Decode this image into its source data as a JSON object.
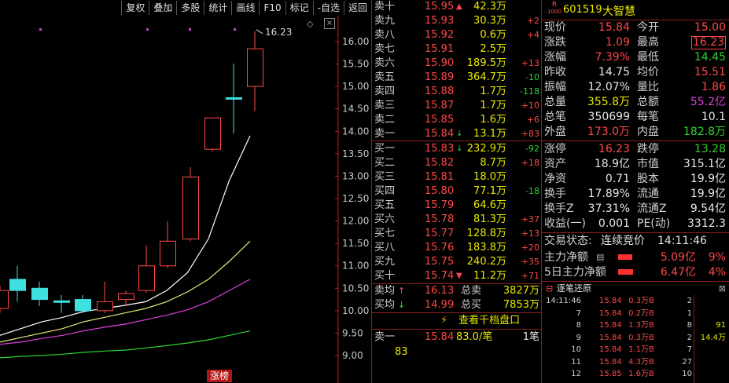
{
  "toolbar": {
    "items": [
      "复权",
      "叠加",
      "多股",
      "统计",
      "画线",
      "F10",
      "标记",
      "-自选",
      "返回"
    ]
  },
  "chart": {
    "y_ticks": [
      "16.00",
      "15.50",
      "15.00",
      "14.50",
      "14.00",
      "13.50",
      "13.00",
      "12.50",
      "12.00",
      "11.50",
      "11.00",
      "10.50",
      "10.00",
      "9.50",
      "9.00"
    ],
    "high_label": "16.23",
    "bottom_tag": "涨榜",
    "diamond": "◇",
    "colors": {
      "up": "#ff4848",
      "down": "#3fe0e0",
      "ma5": "#ffffff",
      "ma10": "#e8e87a",
      "ma20": "#e040e0",
      "ma60": "#2ed32e"
    }
  },
  "chart_data": {
    "type": "candlestick",
    "ylim": [
      8.9,
      16.45
    ],
    "candles": [
      {
        "o": 10.45,
        "h": 10.55,
        "l": 9.95,
        "c": 10.05,
        "dir": "up"
      },
      {
        "o": 10.45,
        "h": 11.0,
        "l": 10.2,
        "c": 10.7,
        "dir": "down"
      },
      {
        "o": 10.5,
        "h": 10.65,
        "l": 10.1,
        "c": 10.25,
        "dir": "down"
      },
      {
        "o": 10.2,
        "h": 10.35,
        "l": 9.95,
        "c": 10.22,
        "dir": "down"
      },
      {
        "o": 10.0,
        "h": 10.35,
        "l": 9.95,
        "c": 10.25,
        "dir": "down"
      },
      {
        "o": 10.0,
        "h": 10.65,
        "l": 9.95,
        "c": 10.2,
        "dir": "up"
      },
      {
        "o": 10.25,
        "h": 10.45,
        "l": 10.1,
        "c": 10.38,
        "dir": "up"
      },
      {
        "o": 10.45,
        "h": 11.45,
        "l": 10.4,
        "c": 11.0,
        "dir": "up"
      },
      {
        "o": 11.0,
        "h": 12.0,
        "l": 10.95,
        "c": 11.55,
        "dir": "up"
      },
      {
        "o": 11.6,
        "h": 13.2,
        "l": 11.55,
        "c": 12.98,
        "dir": "up"
      },
      {
        "o": 13.6,
        "h": 14.3,
        "l": 13.55,
        "c": 14.3,
        "dir": "up"
      },
      {
        "o": 14.75,
        "h": 15.51,
        "l": 13.95,
        "c": 14.75,
        "dir": "down"
      },
      {
        "o": 15.0,
        "h": 16.23,
        "l": 14.45,
        "c": 15.84,
        "dir": "up"
      }
    ],
    "ma": [
      {
        "name": "ma5",
        "values": [
          9.45,
          9.6,
          9.75,
          9.85,
          9.98,
          10.05,
          10.12,
          10.2,
          10.45,
          10.85,
          11.6,
          12.9,
          13.9
        ]
      },
      {
        "name": "ma10",
        "values": [
          9.3,
          9.4,
          9.5,
          9.6,
          9.75,
          9.85,
          9.95,
          10.05,
          10.2,
          10.42,
          10.7,
          11.1,
          11.55
        ]
      },
      {
        "name": "ma20",
        "values": [
          9.25,
          9.3,
          9.38,
          9.45,
          9.55,
          9.63,
          9.7,
          9.8,
          9.9,
          10.02,
          10.2,
          10.45,
          10.7
        ]
      },
      {
        "name": "ma60",
        "values": [
          8.95,
          8.98,
          9.0,
          9.03,
          9.07,
          9.1,
          9.12,
          9.17,
          9.22,
          9.28,
          9.35,
          9.45,
          9.55
        ]
      }
    ]
  },
  "orderbook": {
    "asks": [
      {
        "label": "卖十",
        "price": "15.95",
        "arrow": "▲",
        "vol": "42.3万",
        "chg": ""
      },
      {
        "label": "卖九",
        "price": "15.93",
        "arrow": "",
        "vol": "30.3万",
        "chg": "+2"
      },
      {
        "label": "卖八",
        "price": "15.92",
        "arrow": "",
        "vol": "0.6万",
        "chg": "+4"
      },
      {
        "label": "卖七",
        "price": "15.91",
        "arrow": "",
        "vol": "2.5万",
        "chg": ""
      },
      {
        "label": "卖六",
        "price": "15.90",
        "arrow": "",
        "vol": "189.5万",
        "chg": "+13"
      },
      {
        "label": "卖五",
        "price": "15.89",
        "arrow": "",
        "vol": "364.7万",
        "chg": "-10"
      },
      {
        "label": "卖四",
        "price": "15.88",
        "arrow": "",
        "vol": "1.7万",
        "chg": "-118"
      },
      {
        "label": "卖三",
        "price": "15.87",
        "arrow": "",
        "vol": "1.7万",
        "chg": "+10"
      },
      {
        "label": "卖二",
        "price": "15.85",
        "arrow": "",
        "vol": "1.6万",
        "chg": "+6"
      },
      {
        "label": "卖一",
        "price": "15.84",
        "arrow": "↓",
        "vol": "13.1万",
        "chg": "+83"
      }
    ],
    "bids": [
      {
        "label": "买一",
        "price": "15.83",
        "arrow": "↓",
        "vol": "232.9万",
        "chg": "-92"
      },
      {
        "label": "买二",
        "price": "15.82",
        "arrow": "",
        "vol": "8.7万",
        "chg": "+18"
      },
      {
        "label": "买三",
        "price": "15.81",
        "arrow": "",
        "vol": "18.0万",
        "chg": ""
      },
      {
        "label": "买四",
        "price": "15.80",
        "arrow": "",
        "vol": "77.1万",
        "chg": "-18"
      },
      {
        "label": "买五",
        "price": "15.79",
        "arrow": "",
        "vol": "64.6万",
        "chg": ""
      },
      {
        "label": "买六",
        "price": "15.78",
        "arrow": "",
        "vol": "81.3万",
        "chg": "+37"
      },
      {
        "label": "买七",
        "price": "15.77",
        "arrow": "",
        "vol": "128.8万",
        "chg": "+13"
      },
      {
        "label": "买八",
        "price": "15.76",
        "arrow": "",
        "vol": "183.8万",
        "chg": "+20"
      },
      {
        "label": "买九",
        "price": "15.75",
        "arrow": "",
        "vol": "240.2万",
        "chg": "+35"
      },
      {
        "label": "买十",
        "price": "15.74",
        "arrow": "▼",
        "vol": "11.2万",
        "chg": "+71"
      }
    ],
    "avg_ask": {
      "label": "卖均",
      "arrow": "↑",
      "price": "16.13",
      "total_label": "总卖",
      "total": "3827万"
    },
    "avg_bid": {
      "label": "买均",
      "arrow": "↓",
      "price": "14.99",
      "total_label": "总买",
      "total": "7853万"
    },
    "depth_button": "查看千档盘口",
    "ask1_label": "卖一",
    "ask1_price": "15.84",
    "ask1_avg": "83.0/笔",
    "ask1_count": "1笔",
    "ask1_detail": "83"
  },
  "quote": {
    "badge_top": "R",
    "badge_bottom": "1000",
    "code": "601519",
    "name": "大智慧",
    "rows": [
      {
        "l1": "现价",
        "v1": "15.84",
        "c1": "up",
        "l2": "今开",
        "v2": "15.00",
        "c2": "up"
      },
      {
        "l1": "涨跌",
        "v1": "1.09",
        "c1": "up",
        "l2": "最高",
        "v2": "16.23",
        "c2": "up",
        "box": true
      },
      {
        "l1": "涨幅",
        "v1": "7.39%",
        "c1": "up",
        "l2": "最低",
        "v2": "14.45",
        "c2": "dn"
      },
      {
        "l1": "昨收",
        "v1": "14.75",
        "c1": "wh",
        "l2": "均价",
        "v2": "15.51",
        "c2": "up"
      },
      {
        "l1": "振幅",
        "v1": "12.07%",
        "c1": "wh",
        "l2": "量比",
        "v2": "1.86",
        "c2": "up"
      },
      {
        "l1": "总量",
        "v1": "355.8万",
        "c1": "yl",
        "l2": "总额",
        "v2": "55.2亿",
        "c2": "mg"
      },
      {
        "l1": "总笔",
        "v1": "350699",
        "c1": "wh",
        "l2": "每笔",
        "v2": "10.1",
        "c2": "wh"
      },
      {
        "l1": "外盘",
        "v1": "173.0万",
        "c1": "up",
        "l2": "内盘",
        "v2": "182.8万",
        "c2": "dn"
      }
    ],
    "rows2": [
      {
        "l1": "涨停",
        "v1": "16.23",
        "c1": "up",
        "l2": "跌停",
        "v2": "13.28",
        "c2": "dn"
      },
      {
        "l1": "资产",
        "v1": "18.9亿",
        "c1": "wh",
        "l2": "市值",
        "v2": "315.1亿",
        "c2": "wh"
      },
      {
        "l1": "净资",
        "v1": "0.71",
        "c1": "wh",
        "l2": "股本",
        "v2": "19.9亿",
        "c2": "wh"
      },
      {
        "l1": "换手",
        "v1": "17.89%",
        "c1": "wh",
        "l2": "流通",
        "v2": "19.9亿",
        "c2": "wh"
      },
      {
        "l1": "换手Z",
        "v1": "37.31%",
        "c1": "wh",
        "l2": "流通Z",
        "v2": "9.54亿",
        "c2": "wh"
      },
      {
        "l1": "收益(一)",
        "v1": "0.001",
        "c1": "wh",
        "l2": "PE(动)",
        "v2": "3312.3",
        "c2": "wh"
      }
    ],
    "trade_status_label": "交易状态:",
    "trade_status": "连续竞价",
    "trade_time": "14:11:46",
    "main_net_label": "主力净额",
    "main_net_value": "5.09亿",
    "main_net_pct": "9%",
    "main_net_bar": 0.9,
    "five_day_label": "5日主力净额",
    "five_day_value": "6.47亿",
    "five_day_pct": "4%",
    "five_day_bar": 0.95,
    "tick_header": "逐笔还原",
    "ticks": [
      {
        "t": "14:11:46",
        "p": "15.84",
        "v": "0.3万",
        "s": "B",
        "n": "2",
        "x": ""
      },
      {
        "t": "7",
        "p": "15.84",
        "v": "0.2万",
        "s": "B",
        "n": "1",
        "x": ""
      },
      {
        "t": "8",
        "p": "15.84",
        "v": "1.3万",
        "s": "B",
        "n": "8",
        "x": "91"
      },
      {
        "t": "9",
        "p": "15.84",
        "v": "0.3万",
        "s": "B",
        "n": "2",
        "x": "14.4万"
      },
      {
        "t": "10",
        "p": "15.84",
        "v": "1.1万",
        "s": "B",
        "n": "7",
        "x": ""
      },
      {
        "t": "11",
        "p": "15.84",
        "v": "4.3万",
        "s": "B",
        "n": "27",
        "x": ""
      },
      {
        "t": "12",
        "p": "15.85",
        "v": "1.6万",
        "s": "B",
        "n": "10",
        "x": ""
      }
    ]
  }
}
